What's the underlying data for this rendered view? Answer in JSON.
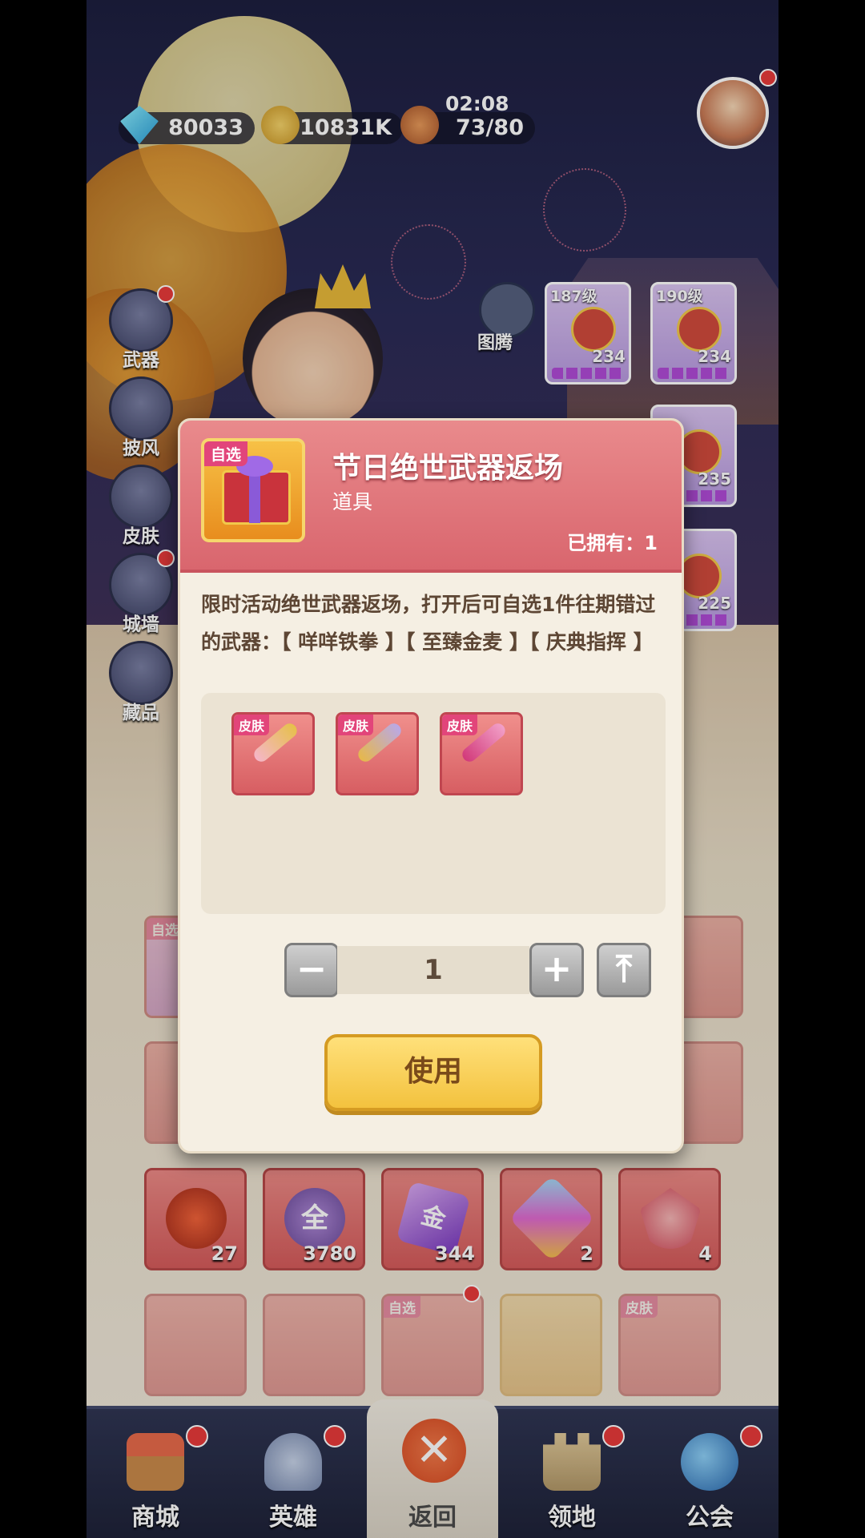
{
  "top_bar": {
    "gems": "80033",
    "gold": "10831K",
    "stamina": "73/80",
    "timer": "02:08"
  },
  "side_menu": [
    {
      "label": "武器",
      "icon": "weapon-icon",
      "badge": true
    },
    {
      "label": "披风",
      "icon": "cape-icon",
      "badge": false
    },
    {
      "label": "皮肤",
      "icon": "skin-icon",
      "badge": false
    },
    {
      "label": "城墙",
      "icon": "wall-icon",
      "badge": true
    },
    {
      "label": "藏品",
      "icon": "collection-icon",
      "badge": false
    }
  ],
  "totem": {
    "label": "图腾"
  },
  "weapon_cards": [
    {
      "level": "187级",
      "power": "234"
    },
    {
      "level": "190级",
      "power": "234"
    },
    {
      "power": "235"
    },
    {
      "power": "225"
    }
  ],
  "modal": {
    "tag": "自选",
    "title": "节日绝世武器返场",
    "subtitle": "道具",
    "owned": "已拥有：1",
    "description": "限时活动绝世武器返场，打开后可自选1件往期错过的武器：【 咩咩铁拳 】【 至臻金麦 】【 庆典指挥 】",
    "rewards": [
      {
        "tag": "皮肤",
        "icon": "sheep-fist-wand-icon"
      },
      {
        "tag": "皮肤",
        "icon": "golden-wheat-wand-icon"
      },
      {
        "tag": "皮肤",
        "icon": "celebration-baton-icon"
      }
    ],
    "quantity": "1",
    "minus": "−",
    "plus": "+",
    "max": "⤒",
    "use_label": "使用"
  },
  "inventory_visible": [
    {
      "qty": "27",
      "icon": "fire-orb-icon"
    },
    {
      "qty": "3780",
      "icon": "全",
      "label": "全"
    },
    {
      "qty": "344",
      "icon": "purple-crystal-icon",
      "label": "金"
    },
    {
      "qty": "2",
      "icon": "rainbow-gem-icon"
    },
    {
      "qty": "4",
      "icon": "winged-gem-icon"
    }
  ],
  "inventory_tags": {
    "auto_select": "自选",
    "skin": "皮肤"
  },
  "bottom_nav": [
    {
      "label": "商城",
      "icon": "shop-icon",
      "badge": true
    },
    {
      "label": "英雄",
      "icon": "hero-helmet-icon",
      "badge": true
    },
    {
      "label": "返回",
      "icon": "close-icon",
      "badge": false,
      "active": true
    },
    {
      "label": "领地",
      "icon": "castle-icon",
      "badge": true
    },
    {
      "label": "公会",
      "icon": "planet-icon",
      "badge": true
    }
  ],
  "colors": {
    "modal_header": "#d9666e",
    "use_button": "#f3c23e",
    "badge": "#e83a3a"
  }
}
